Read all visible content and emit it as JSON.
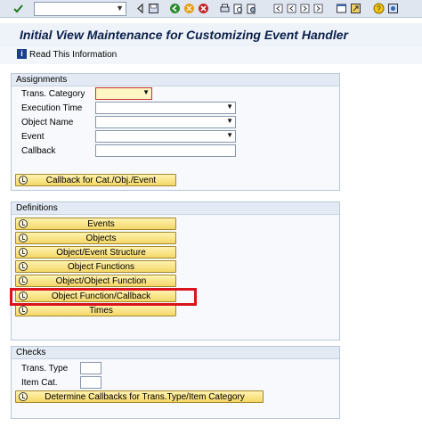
{
  "toolbar": {
    "command_field_value": "",
    "icons": [
      "check-icon",
      "command-dropdown-icon",
      "back-arrow-icon",
      "save-icon",
      "back-icon",
      "exit-icon",
      "cancel-icon",
      "print-icon",
      "find-icon",
      "find-next-icon",
      "first-page-icon",
      "prev-page-icon",
      "next-page-icon",
      "last-page-icon",
      "new-session-icon",
      "shortcut-icon",
      "help-icon",
      "layout-icon"
    ]
  },
  "title": "Initial View Maintenance for Customizing Event Handler",
  "app_toolbar": {
    "read_info_label": "Read This Information"
  },
  "assignments": {
    "title": "Assignments",
    "fields": [
      {
        "label": "Trans. Category",
        "value": ""
      },
      {
        "label": "Execution Time",
        "value": ""
      },
      {
        "label": "Object Name",
        "value": ""
      },
      {
        "label": "Event",
        "value": ""
      },
      {
        "label": "Callback",
        "value": ""
      }
    ],
    "callback_button": "Callback for Cat./Obj./Event"
  },
  "definitions": {
    "title": "Definitions",
    "buttons": [
      "Events",
      "Objects",
      "Object/Event Structure",
      "Object Functions",
      "Object/Object Function",
      "Object Function/Callback",
      "Times"
    ]
  },
  "checks": {
    "title": "Checks",
    "fields": [
      {
        "label": "Trans. Type",
        "value": ""
      },
      {
        "label": "Item Cat.",
        "value": ""
      }
    ],
    "determine_button": "Determine Callbacks for Trans.Type/Item Category"
  },
  "colors": {
    "highlight": "#d9141c",
    "button": "#f4d768",
    "title": "#0b1f4a"
  }
}
